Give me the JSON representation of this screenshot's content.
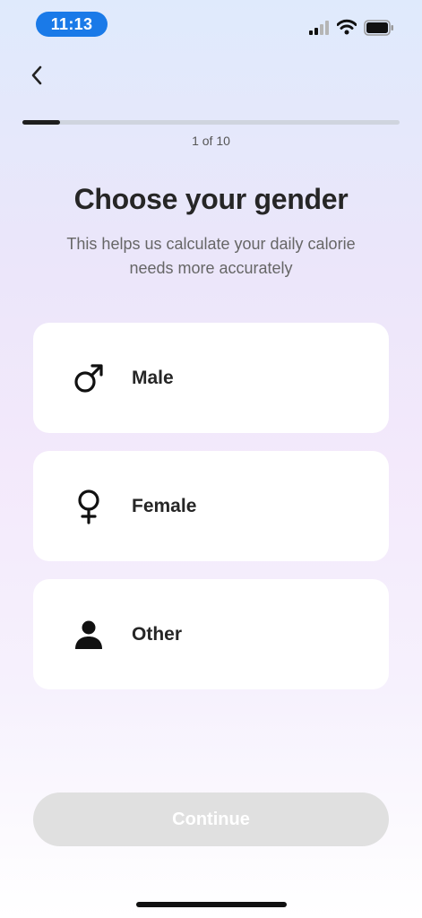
{
  "status_bar": {
    "time": "11:13"
  },
  "progress": {
    "text": "1 of 10",
    "fraction": 0.1
  },
  "header": {
    "title": "Choose your gender",
    "subtitle": "This helps us calculate your daily calorie needs more accurately"
  },
  "options": [
    {
      "label": "Male",
      "icon": "male-symbol-icon"
    },
    {
      "label": "Female",
      "icon": "female-symbol-icon"
    },
    {
      "label": "Other",
      "icon": "person-icon"
    }
  ],
  "continue_button": {
    "label": "Continue",
    "enabled": false
  },
  "colors": {
    "accent": "#1a7ae8",
    "progress_fill": "#1e1e1e",
    "button_disabled": "#e0e0e0"
  }
}
